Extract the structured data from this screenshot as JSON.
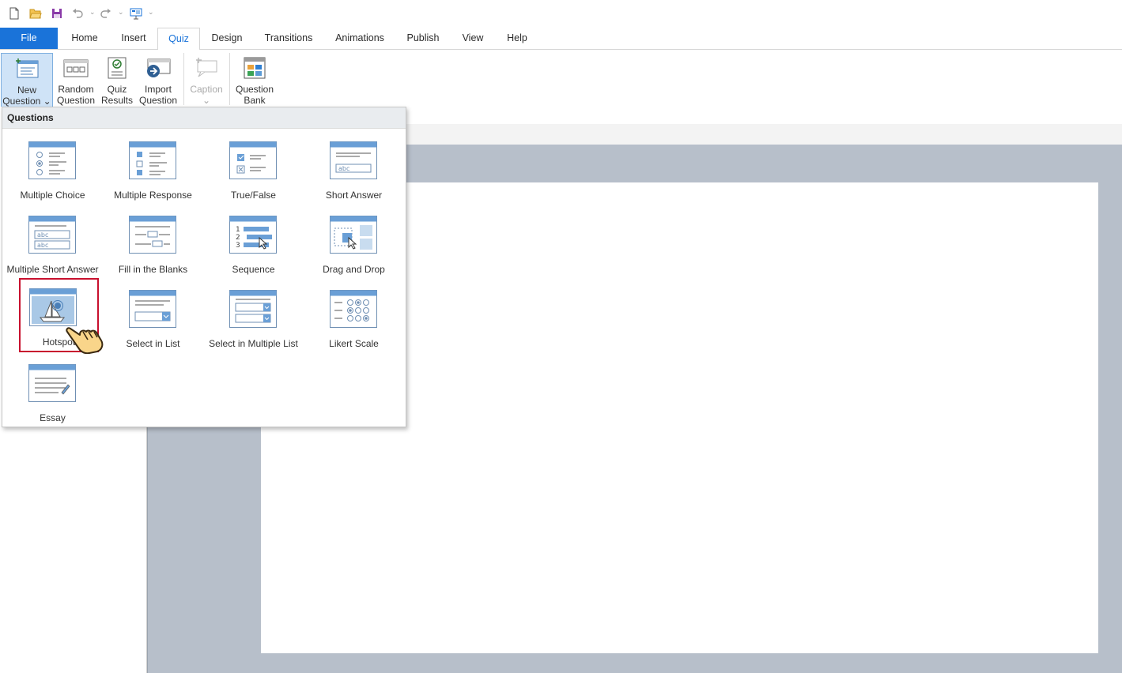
{
  "ribbon_tabs": [
    "File",
    "Home",
    "Insert",
    "Quiz",
    "Design",
    "Transitions",
    "Animations",
    "Publish",
    "View",
    "Help"
  ],
  "active_tab": "Quiz",
  "ribbon": {
    "new_question": [
      "New",
      "Question ⌄"
    ],
    "random_question": [
      "Random",
      "Question"
    ],
    "quiz_results": [
      "Quiz",
      "Results"
    ],
    "import_question": [
      "Import",
      "Question"
    ],
    "caption": [
      "Caption",
      "⌄"
    ],
    "question_bank": [
      "Question",
      "Bank"
    ]
  },
  "dropdown": {
    "header": "Questions",
    "items": [
      "Multiple Choice",
      "Multiple Response",
      "True/False",
      "Short Answer",
      "Multiple Short Answer",
      "Fill in the Blanks",
      "Sequence",
      "Drag and Drop",
      "Hotspot",
      "Select in List",
      "Select in Multiple List",
      "Likert Scale",
      "Essay"
    ],
    "highlighted": "Hotspot"
  },
  "icons": {
    "qat": [
      "new-file-icon",
      "open-folder-icon",
      "save-icon",
      "undo-icon",
      "redo-icon",
      "presentation-icon"
    ],
    "accent": "#1a73d9",
    "highlight": "#c8102e"
  }
}
